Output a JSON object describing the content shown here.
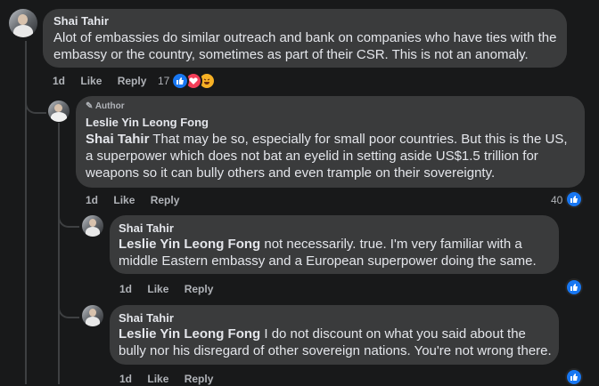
{
  "comments": [
    {
      "author": "Shai Tahir",
      "text": "Alot of embassies do similar outreach and bank on companies who have ties with the embassy or the country, sometimes as part of their CSR. This is not an anomaly.",
      "time": "1d",
      "like_label": "Like",
      "reply_label": "Reply",
      "reaction_count": "17",
      "reactions": [
        "like-icon",
        "love-icon",
        "haha-icon"
      ]
    },
    {
      "badge": "Author",
      "author": "Leslie Yin Leong Fong",
      "mention": "Shai Tahir",
      "text": " That may be so, especially for small poor countries. But this is the US, a superpower which does not bat an eyelid in setting aside US$1.5 trillion for weapons so it can bully others and even trample on their sovereignty.",
      "time": "1d",
      "like_label": "Like",
      "reply_label": "Reply",
      "reaction_count": "40",
      "reactions": [
        "like-icon"
      ]
    },
    {
      "author": "Shai Tahir",
      "mention": "Leslie Yin Leong Fong",
      "text": " not necessarily. true. I'm very familiar with a middle Eastern embassy and a European superpower doing the same.",
      "time": "1d",
      "like_label": "Like",
      "reply_label": "Reply",
      "reactions": [
        "like-icon"
      ]
    },
    {
      "author": "Shai Tahir",
      "mention": "Leslie Yin Leong Fong",
      "text": " I do not discount on what you said about the bully nor his disregard of other sovereign nations. You're not wrong there.",
      "time": "1d",
      "like_label": "Like",
      "reply_label": "Reply",
      "reactions": [
        "like-icon"
      ]
    }
  ],
  "colors": {
    "background": "#18191a",
    "bubble": "#3a3b3c",
    "text": "#e4e6eb",
    "secondary": "#b0b3b8",
    "like_blue": "#1877f2",
    "love_red": "#f33e58",
    "haha_yellow": "#f7b125"
  }
}
